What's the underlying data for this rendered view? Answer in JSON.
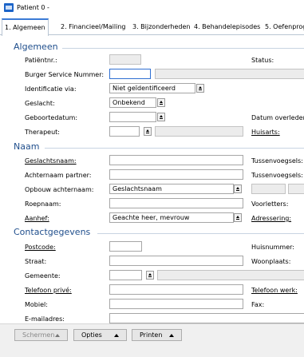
{
  "window": {
    "title": "Patient 0 -"
  },
  "tabs": [
    {
      "label": "1. Algemeen"
    },
    {
      "label": "2. Financieel/Mailing"
    },
    {
      "label": "3. Bijzonderheden"
    },
    {
      "label": "4. Behandelepisodes"
    },
    {
      "label": "5. Oefenprog"
    }
  ],
  "sections": {
    "algemeen": "Algemeen",
    "naam": "Naam",
    "contact": "Contactgegevens"
  },
  "algemeen": {
    "patientnr": {
      "label": "Patiëntnr.:",
      "value": ""
    },
    "status": {
      "label": "Status:"
    },
    "bsn": {
      "label": "Burger Service Nummer:",
      "value": ""
    },
    "identificatie": {
      "label": "Identificatie via:",
      "value": "Niet geïdentificeerd"
    },
    "geslacht": {
      "label": "Geslacht:",
      "value": "Onbekend"
    },
    "geboortedatum": {
      "label": "Geboortedatum:",
      "value": ""
    },
    "datum_overleden": {
      "label": "Datum overleden"
    },
    "therapeut": {
      "label": "Therapeut:",
      "value": ""
    },
    "huisarts": {
      "label": "Huisarts:"
    }
  },
  "naam": {
    "geslachtsnaam": {
      "label": "Geslachtsnaam:",
      "value": ""
    },
    "tussenvoegsels1": {
      "label": "Tussenvoegsels:"
    },
    "achternaam_partner": {
      "label": "Achternaam partner:",
      "value": ""
    },
    "tussenvoegsels2": {
      "label": "Tussenvoegsels:"
    },
    "opbouw": {
      "label": "Opbouw achternaam:",
      "value": "Geslachtsnaam"
    },
    "roepnaam": {
      "label": "Roepnaam:",
      "value": ""
    },
    "voorletters": {
      "label": "Voorletters:"
    },
    "aanhef": {
      "label": "Aanhef:",
      "value": "Geachte heer, mevrouw"
    },
    "adressering": {
      "label": "Adressering:"
    }
  },
  "contact": {
    "postcode": {
      "label": "Postcode:",
      "value": ""
    },
    "huisnummer": {
      "label": "Huisnummer:"
    },
    "straat": {
      "label": "Straat:",
      "value": ""
    },
    "woonplaats": {
      "label": "Woonplaats:"
    },
    "gemeente": {
      "label": "Gemeente:",
      "value": ""
    },
    "telefoon_prive": {
      "label": "Telefoon privé:",
      "value": ""
    },
    "telefoon_werk": {
      "label": "Telefoon werk:"
    },
    "mobiel": {
      "label": "Mobiel:",
      "value": ""
    },
    "fax": {
      "label": "Fax:"
    },
    "email": {
      "label": "E-mailadres:",
      "value": ""
    }
  },
  "footer": {
    "schermen": "Schermen",
    "opties": "Opties",
    "printen": "Printen"
  }
}
